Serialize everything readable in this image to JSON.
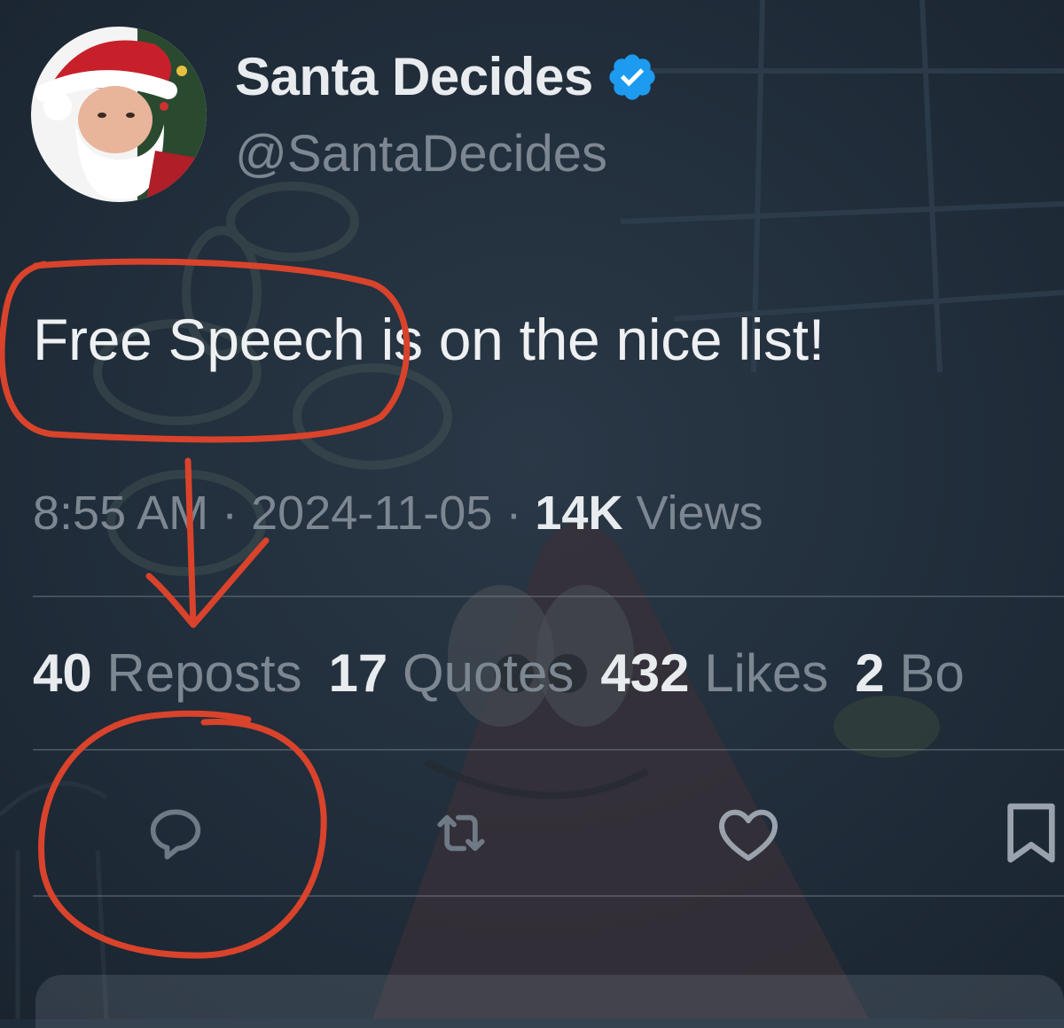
{
  "author": {
    "display_name": "Santa Decides",
    "handle": "@SantaDecides",
    "verified": true,
    "avatar_icon": "santa-claus-avatar"
  },
  "tweet": {
    "text": "Free Speech is on the nice list!",
    "time": "8:55 AM",
    "separator": "·",
    "date": "2024-11-05",
    "views_count": "14K",
    "views_label": "Views"
  },
  "stats": {
    "reposts_count": "40",
    "reposts_label": "Reposts",
    "quotes_count": "17",
    "quotes_label": "Quotes",
    "likes_count": "432",
    "likes_label": "Likes",
    "bookmarks_count": "2",
    "bookmarks_label": "Bo"
  },
  "actions": {
    "reply_icon": "reply-icon",
    "repost_icon": "repost-icon",
    "like_icon": "heart-icon",
    "bookmark_icon": "bookmark-icon"
  },
  "colors": {
    "background": "#1f2c3a",
    "verified_badge": "#1d9bf0",
    "annotation": "#d9432b",
    "muted_text": "#7d8792"
  }
}
